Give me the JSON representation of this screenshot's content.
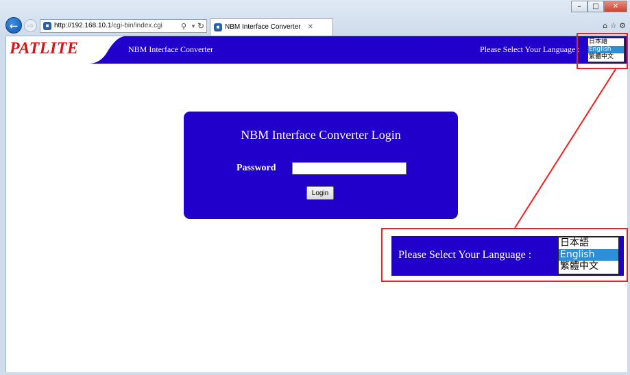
{
  "browser": {
    "address": {
      "host": "http://192.168.10.1",
      "path": "/cgi-bin/index.cgi"
    },
    "tab": {
      "label": "NBM Interface Converter"
    }
  },
  "header": {
    "logo": "PATLITE",
    "title": "NBM Interface Converter",
    "language_label": "Please Select Your Language :",
    "languages": [
      {
        "label": "日本語",
        "selected": false
      },
      {
        "label": "English",
        "selected": true
      },
      {
        "label": "繁體中文",
        "selected": false
      }
    ]
  },
  "login": {
    "title": "NBM Interface Converter Login",
    "password_label": "Password",
    "password_value": "",
    "button_label": "Login"
  },
  "callout": {
    "language_label": "Please Select Your Language :",
    "languages": [
      "日本語",
      "English",
      "繁體中文"
    ]
  },
  "colors": {
    "brand_blue": "#2200cc",
    "logo_red": "#dd1111",
    "highlight_red": "#ff1a1a",
    "selected_option": "#2d8fd8"
  }
}
